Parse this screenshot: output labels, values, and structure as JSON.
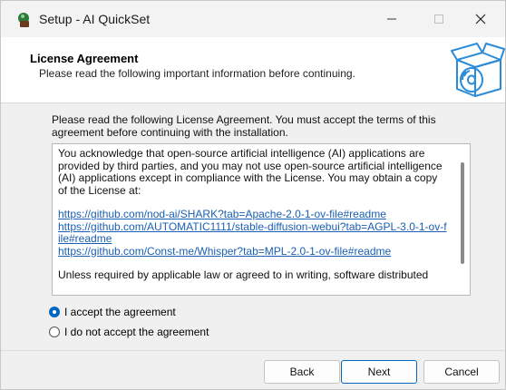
{
  "window": {
    "title": "Setup - AI QuickSet"
  },
  "header": {
    "title": "License Agreement",
    "subtitle": "Please read the following important information before continuing."
  },
  "intro": "Please read the following License Agreement. You must accept the terms of this agreement before continuing with the installation.",
  "license": {
    "paragraph1": "You acknowledge that open-source artificial intelligence (AI) applications are provided by third parties, and you may not use open-source artificial intelligence (AI) applications except in compliance with the License. You may obtain a copy of the License at:",
    "links": [
      "https://github.com/nod-ai/SHARK?tab=Apache-2.0-1-ov-file#readme",
      "https://github.com/AUTOMATIC1111/stable-diffusion-webui?tab=AGPL-3.0-1-ov-file#readme",
      "https://github.com/Const-me/Whisper?tab=MPL-2.0-1-ov-file#readme"
    ],
    "paragraph2": "Unless required by applicable law or agreed to in writing, software distributed"
  },
  "radios": {
    "accept": {
      "label": "I accept the agreement",
      "selected": true
    },
    "decline": {
      "label": "I do not accept the agreement",
      "selected": false
    }
  },
  "buttons": {
    "back": "Back",
    "next": "Next",
    "cancel": "Cancel"
  },
  "colors": {
    "accent": "#0067c0",
    "link": "#1a5fb4"
  }
}
